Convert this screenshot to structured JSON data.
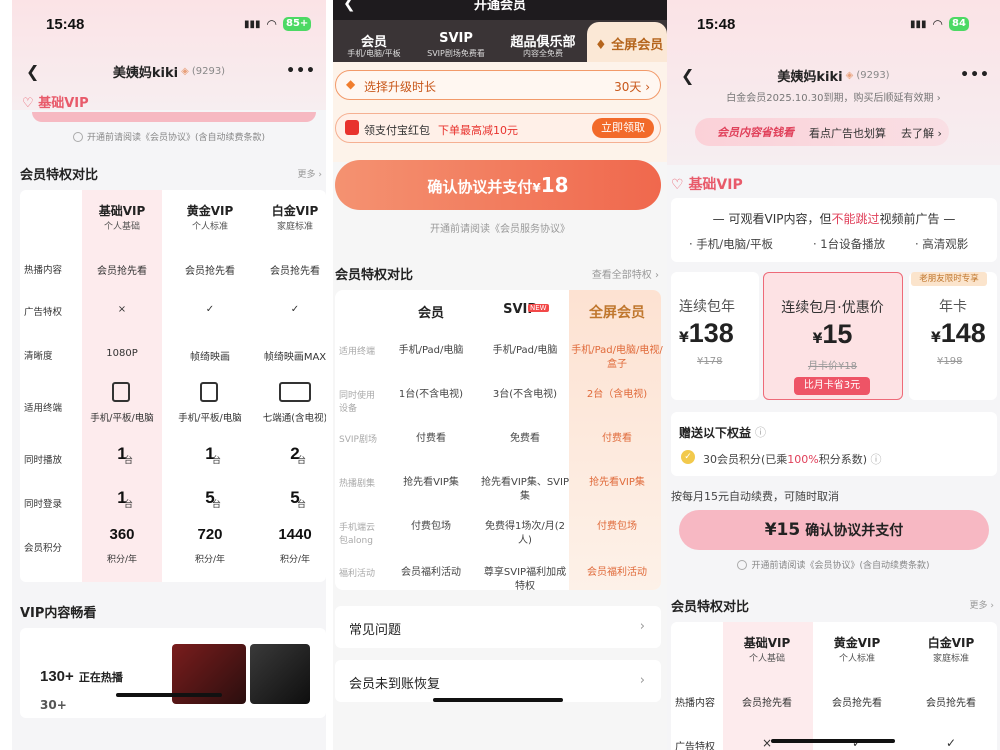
{
  "left": {
    "time": "15:48",
    "battery": "85+",
    "title": "美姨妈kiki",
    "count": "(9293)",
    "tier_title": "基础VIP",
    "agree": "开通前请阅读《会员协议》(含自动续费条款)",
    "compare_title": "会员特权对比",
    "compare_more": "更多 ›",
    "cols": [
      {
        "name": "基础VIP",
        "sub": "个人基础"
      },
      {
        "name": "黄金VIP",
        "sub": "个人标准"
      },
      {
        "name": "白金VIP",
        "sub": "家庭标准"
      }
    ],
    "rows": [
      {
        "label": "热播内容",
        "vals": [
          "会员抢先看",
          "会员抢先看",
          "会员抢先看"
        ]
      },
      {
        "label": "广告特权",
        "vals": [
          "×",
          "✓",
          "✓"
        ]
      },
      {
        "label": "清晰度",
        "vals": [
          "1080P",
          "帧绮映画",
          "帧绮映画MAX"
        ]
      },
      {
        "label": "适用终端",
        "vals": [
          "手机/平板/电脑",
          "手机/平板/电脑",
          "七端通(含电视)"
        ]
      },
      {
        "label": "同时播放",
        "vals": [
          "1",
          "1",
          "2"
        ],
        "unit": "台"
      },
      {
        "label": "同时登录",
        "vals": [
          "1",
          "5",
          "5"
        ],
        "unit": "台"
      },
      {
        "label": "会员积分",
        "vals": [
          "360",
          "720",
          "1440"
        ],
        "unit": "积分/年"
      }
    ],
    "content_title": "VIP内容畅看",
    "hot_count": "130+",
    "hot_label": "正在热播",
    "next_count": "30+"
  },
  "mid": {
    "header_title": "开通会员",
    "tabs": [
      {
        "name": "会员",
        "sub": "手机/电脑/平板"
      },
      {
        "name": "SVIP",
        "sub": "SVIP剧场免费看"
      },
      {
        "name": "超品俱乐部",
        "sub": "内容全免费"
      },
      {
        "name": "全屏会员",
        "sub": ""
      }
    ],
    "duration_label": "选择升级时长",
    "duration_value": "30天 ›",
    "redpack_label": "领支付宝红包",
    "redpack_hl": "下单最高减10元",
    "redpack_btn": "立即领取",
    "pay_btn": "确认协议并支付",
    "pay_price": "18",
    "pay_currency": "¥",
    "agree": "开通前请阅读《会员服务协议》",
    "compare_title": "会员特权对比",
    "compare_more": "查看全部特权 ›",
    "cols": [
      "会员",
      "SVIP",
      "全屏会员"
    ],
    "new_badge": "NEW",
    "rows": [
      {
        "label": "适用终端",
        "vals": [
          "手机/Pad/电脑",
          "手机/Pad/电脑",
          "手机/Pad/电脑/电视/盒子"
        ]
      },
      {
        "label": "同时使用设备",
        "vals": [
          "1台(不含电视)",
          "3台(不含电视)",
          "2台（含电视)"
        ]
      },
      {
        "label": "SVIP剧场",
        "vals": [
          "付费看",
          "免费看",
          "付费看"
        ]
      },
      {
        "label": "热播剧集",
        "vals": [
          "抢先看VIP集",
          "抢先看VIP集、SVIP集",
          "抢先看VIP集"
        ]
      },
      {
        "label": "手机端云包along",
        "vals": [
          "付费包场",
          "免费得1场次/月(2人)",
          "付费包场"
        ]
      },
      {
        "label": "福利活动",
        "vals": [
          "会员福利活动",
          "尊享SVIP福利加成特权",
          "会员福利活动"
        ]
      }
    ],
    "faq": "常见问题",
    "recover": "会员未到账恢复"
  },
  "right": {
    "time": "15:48",
    "battery": "84",
    "title": "美姨妈kiki",
    "count": "(9293)",
    "expire": "白金会员2025.10.30到期，购买后顺延有效期 ›",
    "banner_logo": "会员内容省钱看",
    "banner_text": "看点广告也划算",
    "banner_link": "去了解 ›",
    "tier_title": "基础VIP",
    "feature_line_pre": "可观看VIP内容，但",
    "feature_line_hl": "不能跳过",
    "feature_line_post": "视频前广告",
    "features": [
      "· 手机/电脑/平板",
      "· 1台设备播放",
      "· 高清观影"
    ],
    "plans": [
      {
        "name": "连续包年",
        "price": "138",
        "orig": "¥178",
        "tag": ""
      },
      {
        "name": "连续包月·优惠价",
        "price": "15",
        "orig": "月卡价¥18",
        "tag": "比月卡省3元"
      },
      {
        "name": "年卡",
        "price": "148",
        "orig": "¥198",
        "tag": "老朋友限时专享"
      }
    ],
    "gift_title": "赠送以下权益",
    "gift_item_pre": "30会员积分(已乘",
    "gift_item_hl": "100%",
    "gift_item_post": "积分系数)",
    "renew_note": "按每月15元自动续费，可随时取消",
    "pay_price": "¥15",
    "pay_label": "确认协议并支付",
    "agree": "开通前请阅读《会员协议》(含自动续费条款)",
    "compare_title": "会员特权对比",
    "compare_more": "更多 ›",
    "cols": [
      {
        "name": "基础VIP",
        "sub": "个人基础"
      },
      {
        "name": "黄金VIP",
        "sub": "个人标准"
      },
      {
        "name": "白金VIP",
        "sub": "家庭标准"
      }
    ],
    "row1_label": "热播内容",
    "row1_vals": [
      "会员抢先看",
      "会员抢先看",
      "会员抢先看"
    ],
    "row2_label": "广告特权",
    "row2_vals": [
      "×",
      "✓",
      "✓"
    ]
  },
  "colors": {
    "brand": "#ff6a4a",
    "pink": "#e85a6a",
    "gold": "#c58a3c"
  }
}
